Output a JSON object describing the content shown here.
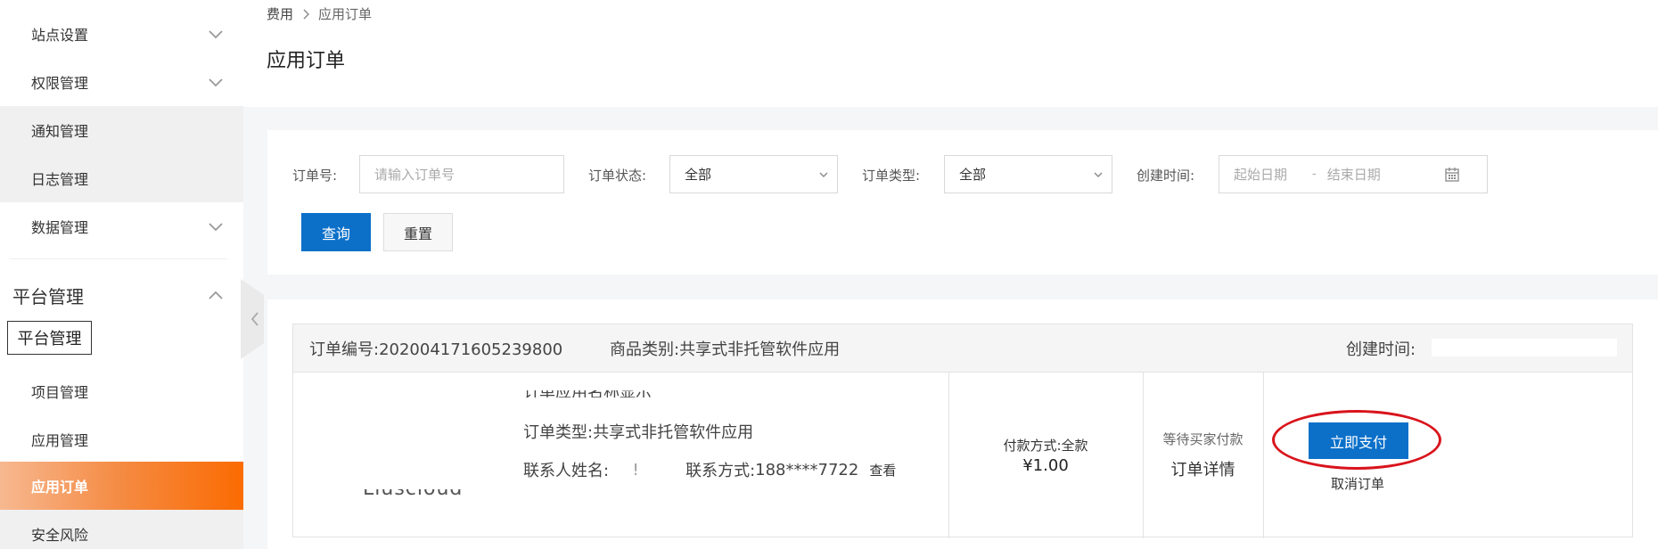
{
  "sidebar": {
    "items": [
      {
        "label": "站点设置",
        "has_chevron": true
      },
      {
        "label": "权限管理",
        "has_chevron": true
      },
      {
        "label": "通知管理",
        "has_chevron": false
      },
      {
        "label": "日志管理",
        "has_chevron": false
      },
      {
        "label": "数据管理",
        "has_chevron": true
      }
    ],
    "group": {
      "label": "平台管理",
      "expanded": true
    },
    "tooltip": "平台管理",
    "sub_items": [
      {
        "label": "项目管理"
      },
      {
        "label": "应用管理"
      },
      {
        "label": "应用订单",
        "active": true
      },
      {
        "label": "安全风险"
      }
    ]
  },
  "breadcrumb": [
    "费用",
    "应用订单"
  ],
  "page_title": "应用订单",
  "filter": {
    "order_no_label": "订单号:",
    "order_no_placeholder": "请输入订单号",
    "status_label": "订单状态:",
    "status_value": "全部",
    "type_label": "订单类型:",
    "type_value": "全部",
    "time_label": "创建时间:",
    "start_placeholder": "起始日期",
    "date_sep": "-",
    "end_placeholder": "结束日期",
    "query_button": "查询",
    "reset_button": "重置"
  },
  "order": {
    "no_label": "订单编号:",
    "no_value": "202004171605239800",
    "category_label": "商品类别:",
    "category_value": "共享式非托管软件应用",
    "created_label": "创建时间:",
    "logo_text": "Liuscloud",
    "clipped_title": "订单应用名称显示",
    "type_line": "订单类型:共享式非托管软件应用",
    "contact_name_label": "联系人姓名:",
    "contact_name_value": "!",
    "contact_phone_label": "联系方式:",
    "contact_phone_value": "188****7722",
    "view_link": "查看",
    "pay_method": "付款方式:全款",
    "amount": "¥1.00",
    "status": "等待买家付款",
    "detail_link": "订单详情",
    "pay_button": "立即支付",
    "cancel_link": "取消订单"
  },
  "colors": {
    "primary": "#0c70c9",
    "active_gradient_end": "#fb6b02",
    "annotation_red": "#d9141c"
  }
}
